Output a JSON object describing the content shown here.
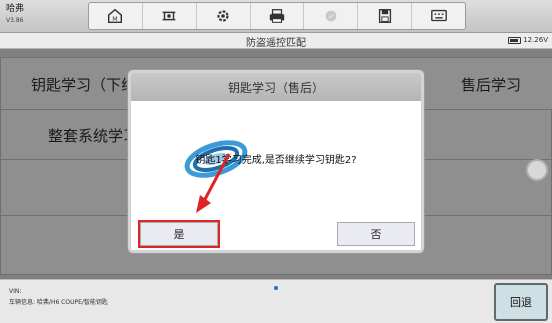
{
  "app": {
    "brand": "哈弗",
    "version": "V3.86"
  },
  "toolbar": {
    "icons": [
      "home-icon",
      "vehicle-lift-icon",
      "settings-icon",
      "printer-icon",
      "disabled-check-icon",
      "save-icon",
      "keyboard-icon"
    ]
  },
  "subtitle": "防盗遥控匹配",
  "battery": {
    "voltage": "12.26V"
  },
  "menu": {
    "key_learning_presale": "钥匙学习（下线）",
    "key_learning_aftersale": "售后学习",
    "whole_system_learning": "整套系统学习"
  },
  "dialog": {
    "title": "钥匙学习（售后）",
    "message": "钥匙1学习完成,是否继续学习钥匙2?",
    "yes": "是",
    "no": "否"
  },
  "footer": {
    "vin_label": "VIN:",
    "vehicle_info": "车辆信息: 哈弗/H6 COUPE/智能钥匙",
    "back": "回退"
  },
  "colors": {
    "highlight": "#e02424",
    "accent": "#2a6db5"
  }
}
